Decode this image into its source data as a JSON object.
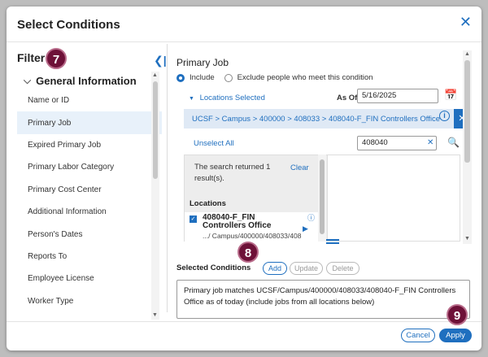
{
  "dialog": {
    "title": "Select Conditions",
    "close_icon": "close-icon"
  },
  "filter": {
    "heading": "Filter",
    "section": "General Information",
    "items": [
      {
        "label": "Name or ID"
      },
      {
        "label": "Primary Job"
      },
      {
        "label": "Expired Primary Job"
      },
      {
        "label": "Primary Labor Category"
      },
      {
        "label": "Primary Cost Center"
      },
      {
        "label": "Additional Information"
      },
      {
        "label": "Person's Dates"
      },
      {
        "label": "Reports To"
      },
      {
        "label": "Employee License"
      },
      {
        "label": "Worker Type"
      }
    ],
    "active_item": "Primary Job"
  },
  "badges": {
    "step7": "7",
    "step8": "8",
    "step9": "9"
  },
  "primary_job": {
    "title": "Primary Job",
    "include_label": "Include",
    "exclude_label": "Exclude people who meet this condition",
    "locations_toggle": "Locations Selected",
    "as_of_label": "As Of",
    "as_of_value": "5/16/2025",
    "breadcrumb": "UCSF > Campus > 400000 > 408033 > 408040-F_FIN Controllers Office",
    "unselect_all": "Unselect All",
    "search_value": "408040",
    "search_result_msg": "The search returned 1 result(s).",
    "clear_label": "Clear",
    "locations_heading": "Locations",
    "result_name": "408040-F_FIN Controllers Office",
    "result_path": ".../ Campus/400000/408033/408"
  },
  "selected_conditions": {
    "label": "Selected Conditions",
    "add": "Add",
    "update": "Update",
    "delete": "Delete",
    "text": "Primary job matches UCSF/Campus/400000/408033/408040-F_FIN Controllers Office as of today (include jobs from all locations below)"
  },
  "footer": {
    "cancel": "Cancel",
    "apply": "Apply"
  },
  "colors": {
    "accent": "#1f6fbf",
    "badge": "#6e1138"
  }
}
